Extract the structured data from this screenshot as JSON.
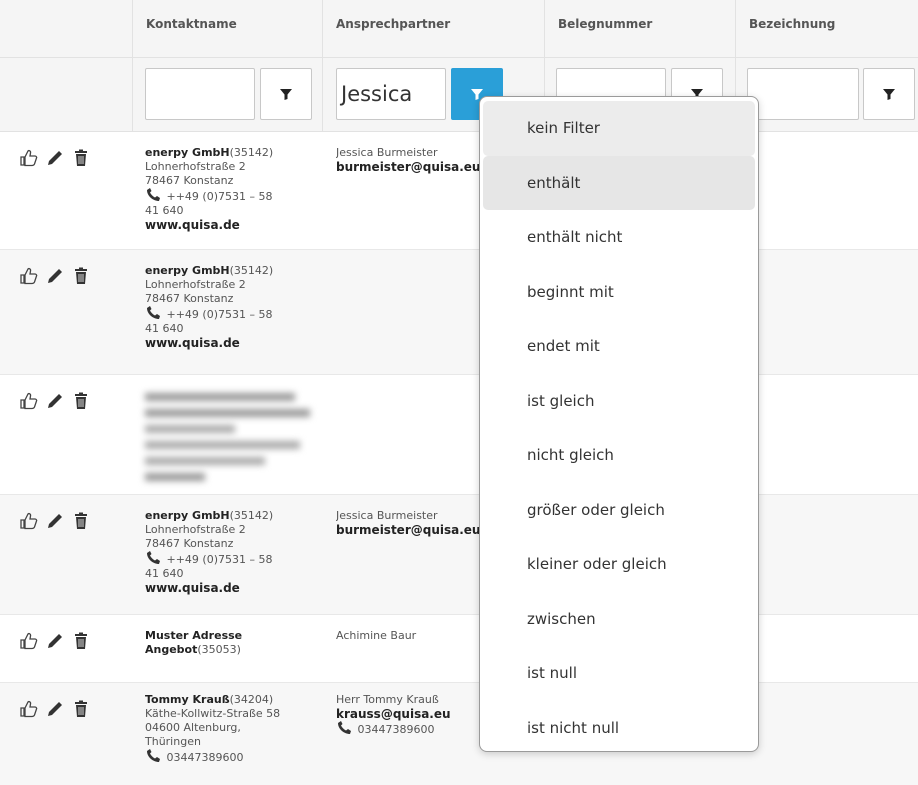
{
  "columns": [
    "Kontaktname",
    "Ansprechpartner",
    "Belegnummer",
    "Bezeichnung"
  ],
  "filters": {
    "kontaktname_value": "",
    "ansprechpartner_value": "Jessica",
    "belegnummer_value": "",
    "bezeichnung_value": ""
  },
  "rows": [
    {
      "company": "enerpy GmbH",
      "id": "(35142)",
      "street": "Lohnerhofstraße 2",
      "city": "78467 Konstanz",
      "phone": "++49 (0)7531 – 58",
      "phone2": "41 640",
      "web": "www.quisa.de",
      "person": "Jessica Burmeister",
      "email": "burmeister@quisa.eu"
    },
    {
      "company": "enerpy GmbH",
      "id": "(35142)",
      "street": "Lohnerhofstraße 2",
      "city": "78467 Konstanz",
      "phone": "++49 (0)7531 – 58",
      "phone2": "41 640",
      "web": "www.quisa.de"
    },
    {
      "blurred": "Blurred contact data"
    },
    {
      "company": "enerpy GmbH",
      "id": "(35142)",
      "street": "Lohnerhofstraße 2",
      "city": "78467 Konstanz",
      "phone": "++49 (0)7531 – 58",
      "phone2": "41 640",
      "web": "www.quisa.de",
      "person": "Jessica Burmeister",
      "email": "burmeister@quisa.eu"
    },
    {
      "company": "Muster Adresse",
      "company2": "Angebot",
      "id": "(35053)",
      "person": "Achimine Baur"
    },
    {
      "company": "Tommy Krauß",
      "id": "(34204)",
      "street": "Käthe-Kollwitz-Straße 58",
      "city": "04600 Altenburg,",
      "region": "Thüringen",
      "phone": "03447389600",
      "person": "Herr Tommy Krauß",
      "email": "krauss@quisa.eu",
      "person_phone": "03447389600"
    }
  ],
  "filter_menu": {
    "items": [
      "kein Filter",
      "enthält",
      "enthält nicht",
      "beginnt mit",
      "endet mit",
      "ist gleich",
      "nicht gleich",
      "größer oder gleich",
      "kleiner oder gleich",
      "zwischen",
      "ist null",
      "ist nicht null"
    ],
    "highlighted_index": 1
  },
  "icons": {
    "like": "thumbs-up-icon",
    "edit": "pencil-icon",
    "delete": "trash-icon",
    "filter": "funnel-icon",
    "phone": "phone-icon"
  },
  "colors": {
    "accent": "#2a9fd8",
    "header_bg": "#f5f5f5"
  }
}
